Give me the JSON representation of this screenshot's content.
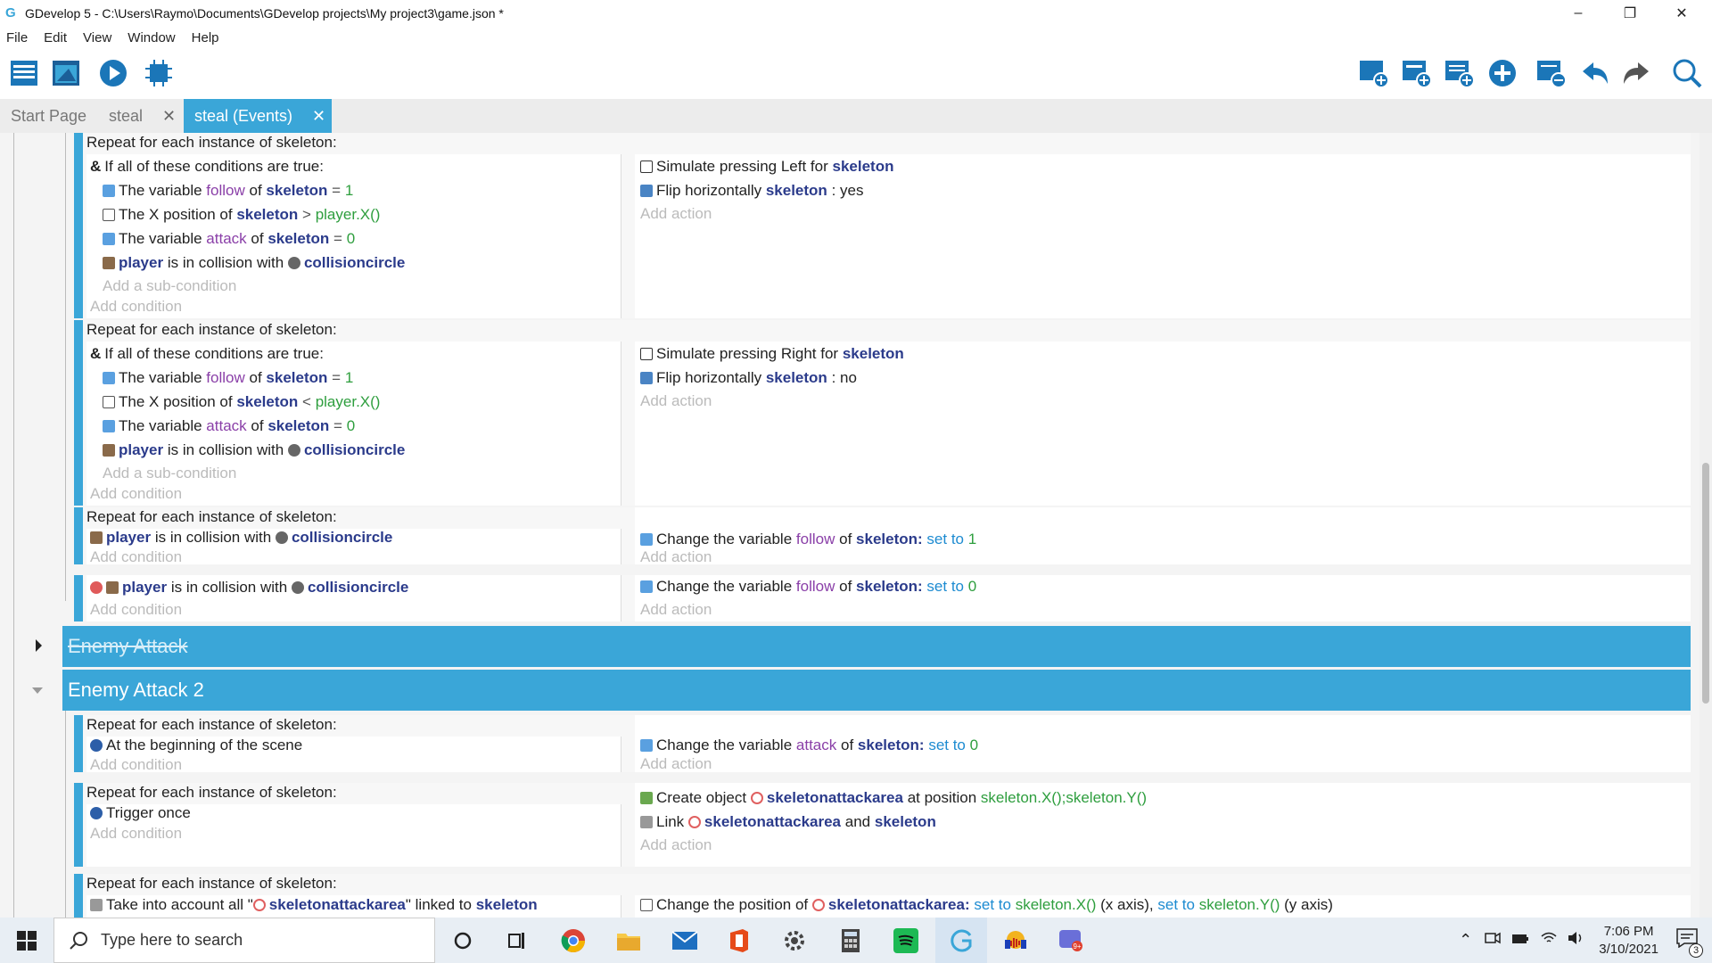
{
  "window": {
    "title": "GDevelop 5 - C:\\Users\\Raymo\\Documents\\GDevelop projects\\My project3\\game.json *"
  },
  "menu": [
    "File",
    "Edit",
    "View",
    "Window",
    "Help"
  ],
  "tabs": [
    {
      "label": "Start Page",
      "closable": false,
      "active": false
    },
    {
      "label": "steal",
      "closable": true,
      "active": false
    },
    {
      "label": "steal (Events)",
      "closable": true,
      "active": true
    }
  ],
  "placeholders": {
    "add_condition": "Add condition",
    "add_action": "Add action",
    "add_subcondition": "Add a sub-condition"
  },
  "events": {
    "e1": {
      "header": "Repeat for each instance of skeleton:",
      "all_true": "If all of these conditions are true:",
      "c1": [
        "The variable",
        "follow",
        "of",
        "skeleton",
        "= ",
        "1"
      ],
      "c2": [
        "The X position of",
        "skeleton",
        ">",
        "player.X()"
      ],
      "c3": [
        "The variable",
        "attack",
        "of",
        "skeleton",
        "= ",
        "0"
      ],
      "c4": [
        "player",
        "is in collision with",
        "collisioncircle"
      ],
      "a1": [
        "Simulate pressing Left for",
        "skeleton"
      ],
      "a2": [
        "Flip horizontally",
        "skeleton",
        ": yes"
      ]
    },
    "e2": {
      "header": "Repeat for each instance of skeleton:",
      "all_true": "If all of these conditions are true:",
      "c1": [
        "The variable",
        "follow",
        "of",
        "skeleton",
        "= ",
        "1"
      ],
      "c2": [
        "The X position of",
        "skeleton",
        "<",
        "player.X()"
      ],
      "c3": [
        "The variable",
        "attack",
        "of",
        "skeleton",
        "= ",
        "0"
      ],
      "c4": [
        "player",
        "is in collision with",
        "collisioncircle"
      ],
      "a1": [
        "Simulate pressing Right for",
        "skeleton"
      ],
      "a2": [
        "Flip horizontally",
        "skeleton",
        ": no"
      ]
    },
    "e3": {
      "header": "Repeat for each instance of skeleton:",
      "c1": [
        "player",
        "is in collision with",
        "collisioncircle"
      ],
      "a1": [
        "Change the variable",
        "follow",
        "of",
        "skeleton",
        ":",
        "set to",
        "1"
      ]
    },
    "e4": {
      "c1": [
        "player",
        "is in collision with",
        "collisioncircle"
      ],
      "a1": [
        "Change the variable",
        "follow",
        "of",
        "skeleton",
        ":",
        "set to",
        "0"
      ]
    },
    "g1": "Enemy Attack",
    "g2": "Enemy Attack 2",
    "e5": {
      "header": "Repeat for each instance of skeleton:",
      "c1": "At the beginning of the scene",
      "a1": [
        "Change the variable",
        "attack",
        "of",
        "skeleton",
        ":",
        "set to",
        "0"
      ]
    },
    "e6": {
      "header": "Repeat for each instance of skeleton:",
      "c1": "Trigger once",
      "a1": [
        "Create object",
        "skeletonattackarea",
        "at position",
        "skeleton.X();skeleton.Y()"
      ],
      "a2": [
        "Link",
        "skeletonattackarea",
        "and",
        "skeleton"
      ]
    },
    "e7": {
      "header": "Repeat for each instance of skeleton:",
      "c1": [
        "Take into account all \"",
        "skeletonattackarea",
        "\" linked to",
        "skeleton"
      ],
      "a1": [
        "Change the position of",
        "skeletonattackarea",
        ":",
        "set to",
        "skeleton.X()",
        "(x axis),",
        "set to",
        "skeleton.Y()",
        "(y axis)"
      ]
    }
  },
  "taskbar": {
    "search_placeholder": "Type here to search",
    "time": "7:06 PM",
    "date": "3/10/2021",
    "notifications": "3"
  },
  "colors": {
    "accent": "#3aa6d8",
    "object": "#2b3b8b",
    "variable": "#8a3fa8",
    "value": "#2e9e3e"
  }
}
